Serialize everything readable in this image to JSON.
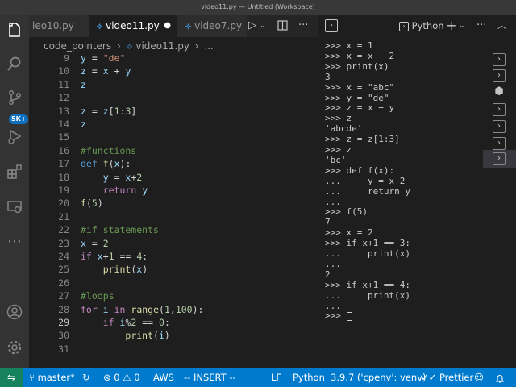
{
  "window": {
    "title": "video11.py — Untitled (Workspace)"
  },
  "activity_bar": {
    "badge": "5K+"
  },
  "tabs": [
    {
      "label": "leo10.py"
    },
    {
      "label": "video11.py",
      "dirty": "●"
    },
    {
      "label": "video7.py"
    }
  ],
  "breadcrumb": {
    "folder": "code_pointers",
    "sep1": "›",
    "file": "video11.py",
    "sep2": "›",
    "more": "..."
  },
  "editor": {
    "lines": [
      {
        "n": "9",
        "text": "y = \"de\""
      },
      {
        "n": "10",
        "text": "z = x + y"
      },
      {
        "n": "11",
        "text": "z"
      },
      {
        "n": "12",
        "text": ""
      },
      {
        "n": "13",
        "text": "z = z[1:3]"
      },
      {
        "n": "14",
        "text": "z"
      },
      {
        "n": "15",
        "text": ""
      },
      {
        "n": "16",
        "text": "#functions"
      },
      {
        "n": "17",
        "text": "def f(x):"
      },
      {
        "n": "18",
        "text": "    y = x+2"
      },
      {
        "n": "19",
        "text": "    return y"
      },
      {
        "n": "20",
        "text": "f(5)"
      },
      {
        "n": "21",
        "text": ""
      },
      {
        "n": "22",
        "text": "#if statements"
      },
      {
        "n": "23",
        "text": "x = 2"
      },
      {
        "n": "24",
        "text": "if x+1 == 4:"
      },
      {
        "n": "25",
        "text": "    print(x)"
      },
      {
        "n": "26",
        "text": ""
      },
      {
        "n": "27",
        "text": "#loops"
      },
      {
        "n": "28",
        "text": "for i in range(1,100):"
      },
      {
        "n": "29",
        "text": "    if i%2 == 0:"
      },
      {
        "n": "30",
        "text": "        print(i)"
      },
      {
        "n": "31",
        "text": ""
      }
    ],
    "current_line": "29"
  },
  "terminal": {
    "tab_label": "Python",
    "lines": [
      ">>> x = 1",
      ">>> x = x + 2",
      ">>> print(x)",
      "3",
      ">>> x = \"abc\"",
      ">>> y = \"de\"",
      ">>> z = x + y",
      ">>> z",
      "'abcde'",
      ">>> z = z[1:3]",
      ">>> z",
      "'bc'",
      ">>> def f(x):",
      "...     y = x+2",
      "...     return y",
      "...",
      ">>> f(5)",
      "7",
      ">>> x = 2",
      ">>> if x+1 == 3:",
      "...     print(x)",
      "...",
      "2",
      ">>> if x+1 == 4:",
      "...     print(x)",
      "...",
      ">>> "
    ]
  },
  "statusbar": {
    "branch": "master*",
    "errors": "0",
    "warnings": "0",
    "aws": "AWS",
    "mode": "-- INSERT --",
    "eol": "LF",
    "language": "Python",
    "interpreter": "3.9.7 ('cpenv': venv)",
    "prettier": "Prettier"
  }
}
